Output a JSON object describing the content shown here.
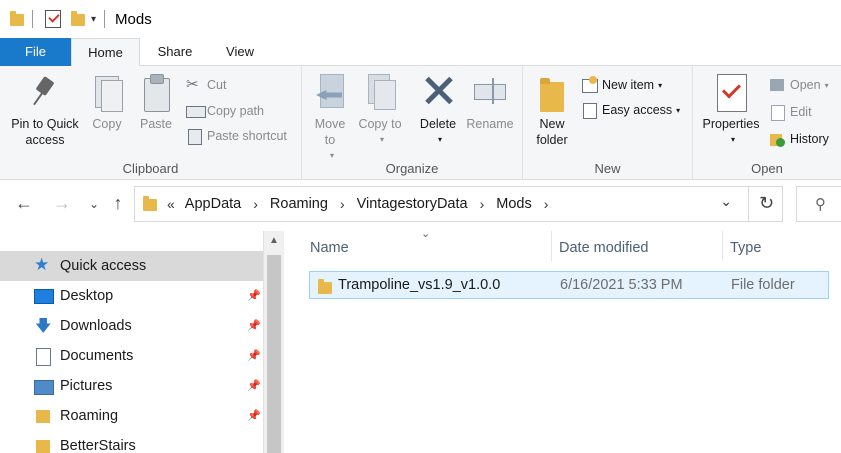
{
  "window": {
    "title": "Mods"
  },
  "tabs": {
    "file": "File",
    "home": "Home",
    "share": "Share",
    "view": "View"
  },
  "ribbon": {
    "clipboard": {
      "label": "Clipboard",
      "pin": "Pin to Quick access",
      "copy": "Copy",
      "paste": "Paste",
      "cut": "Cut",
      "copy_path": "Copy path",
      "paste_shortcut": "Paste shortcut"
    },
    "organize": {
      "label": "Organize",
      "move_to": "Move to",
      "copy_to": "Copy to",
      "delete": "Delete",
      "rename": "Rename"
    },
    "new": {
      "label": "New",
      "new_folder": "New folder",
      "new_item": "New item",
      "easy_access": "Easy access"
    },
    "open": {
      "label": "Open",
      "properties": "Properties",
      "open": "Open",
      "edit": "Edit",
      "history": "History"
    }
  },
  "address": {
    "overflow": "«",
    "crumbs": [
      "AppData",
      "Roaming",
      "VintagestoryData",
      "Mods"
    ]
  },
  "navpane": {
    "items": [
      {
        "label": "Quick access",
        "icon": "star-icon",
        "pinned": false
      },
      {
        "label": "Desktop",
        "icon": "desktop-icon",
        "pinned": true
      },
      {
        "label": "Downloads",
        "icon": "download-icon",
        "pinned": true
      },
      {
        "label": "Documents",
        "icon": "documents-icon",
        "pinned": true
      },
      {
        "label": "Pictures",
        "icon": "pictures-icon",
        "pinned": true
      },
      {
        "label": "Roaming",
        "icon": "folder-icon",
        "pinned": true
      },
      {
        "label": "BetterStairs",
        "icon": "folder-icon",
        "pinned": false
      }
    ]
  },
  "filelist": {
    "columns": {
      "name": "Name",
      "date": "Date modified",
      "type": "Type"
    },
    "rows": [
      {
        "name": "Trampoline_vs1.9_v1.0.0",
        "date": "6/16/2021 5:33 PM",
        "type": "File folder"
      }
    ]
  },
  "colors": {
    "accent": "#1979ca",
    "folder": "#e8b84a",
    "selection": "#e5f3ff"
  }
}
